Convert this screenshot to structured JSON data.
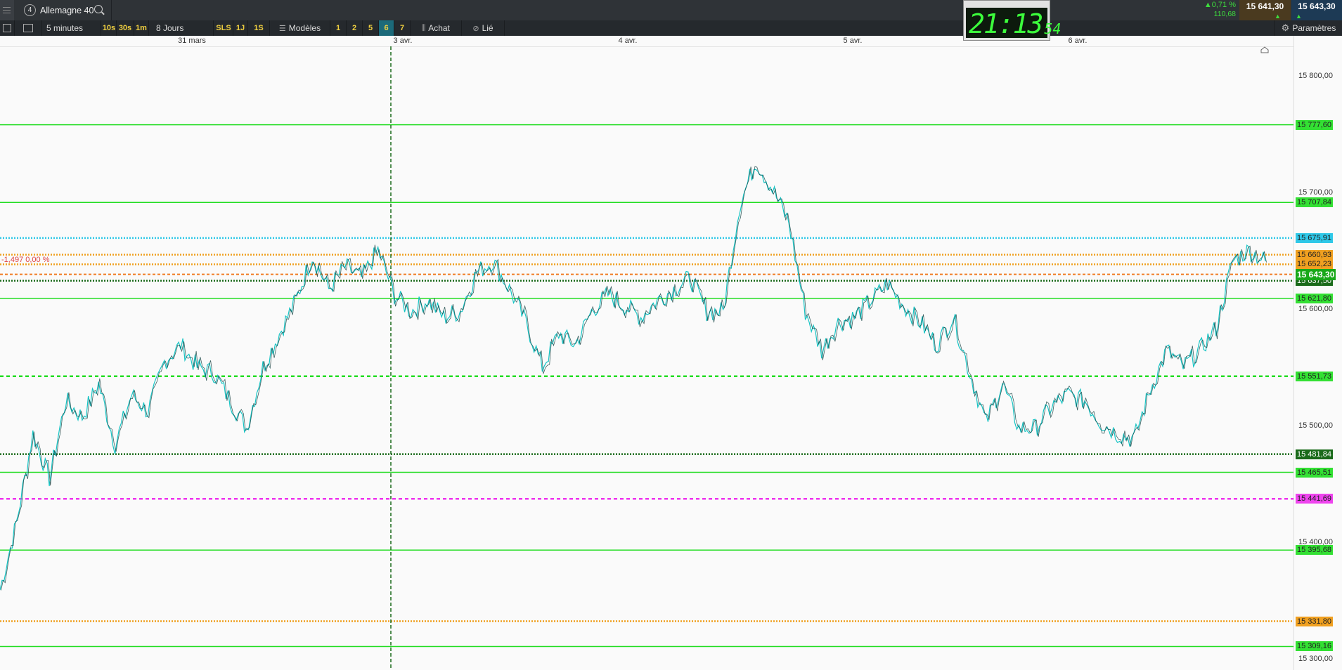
{
  "header": {
    "instrument_number": "4",
    "instrument_name": "Allemagne 40",
    "change_pct": "0,71 %",
    "change_abs": "110,68",
    "bid": "15 641,30",
    "ask": "15 643,30"
  },
  "clock": {
    "hm": "21:13",
    "ss": "54"
  },
  "toolbar": {
    "interval": "5 minutes",
    "quick_intervals": [
      "10s",
      "30s",
      "1m"
    ],
    "period": "8 Jours",
    "periods": [
      "SLS",
      "1J",
      "1S"
    ],
    "models_label": "Modèles",
    "layouts": [
      "1",
      "2",
      "5",
      "6",
      "7"
    ],
    "selected_layout": "6",
    "buy_label": "Achat",
    "linked_label": "Lié",
    "settings_label": "Paramètres"
  },
  "chart_data": {
    "type": "line",
    "date_labels": [
      "31 mars",
      "3 avr.",
      "4 avr.",
      "5 avr.",
      "6 avr."
    ],
    "ylim": [
      15288,
      15848
    ],
    "price_ticks": [
      "15 800,00",
      "15 700,00",
      "15 600,00",
      "15 500,00",
      "15 400,00",
      "15 300,00"
    ],
    "current_price": "15 643,30",
    "pct_label": "-1,497 0,00 %",
    "levels": [
      {
        "value": "15 777,60",
        "color": "#22dd22",
        "style": "solid",
        "tag_bg": "#33e033"
      },
      {
        "value": "15 707,84",
        "color": "#22dd22",
        "style": "solid",
        "tag_bg": "#33e033"
      },
      {
        "value": "15 675,91",
        "color": "#2fc8e8",
        "style": "dotted",
        "tag_bg": "#2fc8e8"
      },
      {
        "value": "15 660,93",
        "color": "#f0a020",
        "style": "dotted",
        "tag_bg": "#f0a020"
      },
      {
        "value": "15 652,23",
        "color": "#f0a020",
        "style": "dotted",
        "tag_bg": "#f0a020"
      },
      {
        "value": "15 637,50",
        "color": "#1a6a1a",
        "style": "dotted",
        "tag_bg": "#1a6a1a"
      },
      {
        "value": "15 621,80",
        "color": "#22dd22",
        "style": "solid",
        "tag_bg": "#33e033"
      },
      {
        "value": "15 551,73",
        "color": "#22dd22",
        "style": "dashed",
        "tag_bg": "#33e033"
      },
      {
        "value": "15 481,84",
        "color": "#1a6a1a",
        "style": "dotted",
        "tag_bg": "#1a6a1a"
      },
      {
        "value": "15 465,51",
        "color": "#22dd22",
        "style": "solid",
        "tag_bg": "#33e033"
      },
      {
        "value": "15 441,69",
        "color": "#ee33ee",
        "style": "dashed",
        "tag_bg": "#ee44ee"
      },
      {
        "value": "15 395,68",
        "color": "#22dd22",
        "style": "solid",
        "tag_bg": "#33e033"
      },
      {
        "value": "15 331,80",
        "color": "#f0a020",
        "style": "dotted",
        "tag_bg": "#f0a020"
      },
      {
        "value": "15 309,16",
        "color": "#22dd22",
        "style": "solid",
        "tag_bg": "#33e033"
      }
    ],
    "series": [
      {
        "values": [
          15360,
          15420,
          15500,
          15460,
          15530,
          15515,
          15545,
          15490,
          15535,
          15520,
          15565,
          15580,
          15560,
          15555,
          15530,
          15505,
          15560,
          15590,
          15620,
          15660,
          15630,
          15650,
          15640,
          15665,
          15625,
          15610,
          15620,
          15605,
          15610,
          15645,
          15655,
          15630,
          15600,
          15560,
          15590,
          15580,
          15610,
          15625,
          15615,
          15605,
          15620,
          15630,
          15640,
          15610,
          15610,
          15705,
          15745,
          15720,
          15690,
          15610,
          15575,
          15600,
          15605,
          15620,
          15635,
          15615,
          15600,
          15580,
          15605,
          15555,
          15510,
          15545,
          15505,
          15505,
          15525,
          15535,
          15530,
          15510,
          15500,
          15495,
          15540,
          15575,
          15560,
          15575,
          15595,
          15655,
          15665,
          15655
        ]
      }
    ]
  }
}
